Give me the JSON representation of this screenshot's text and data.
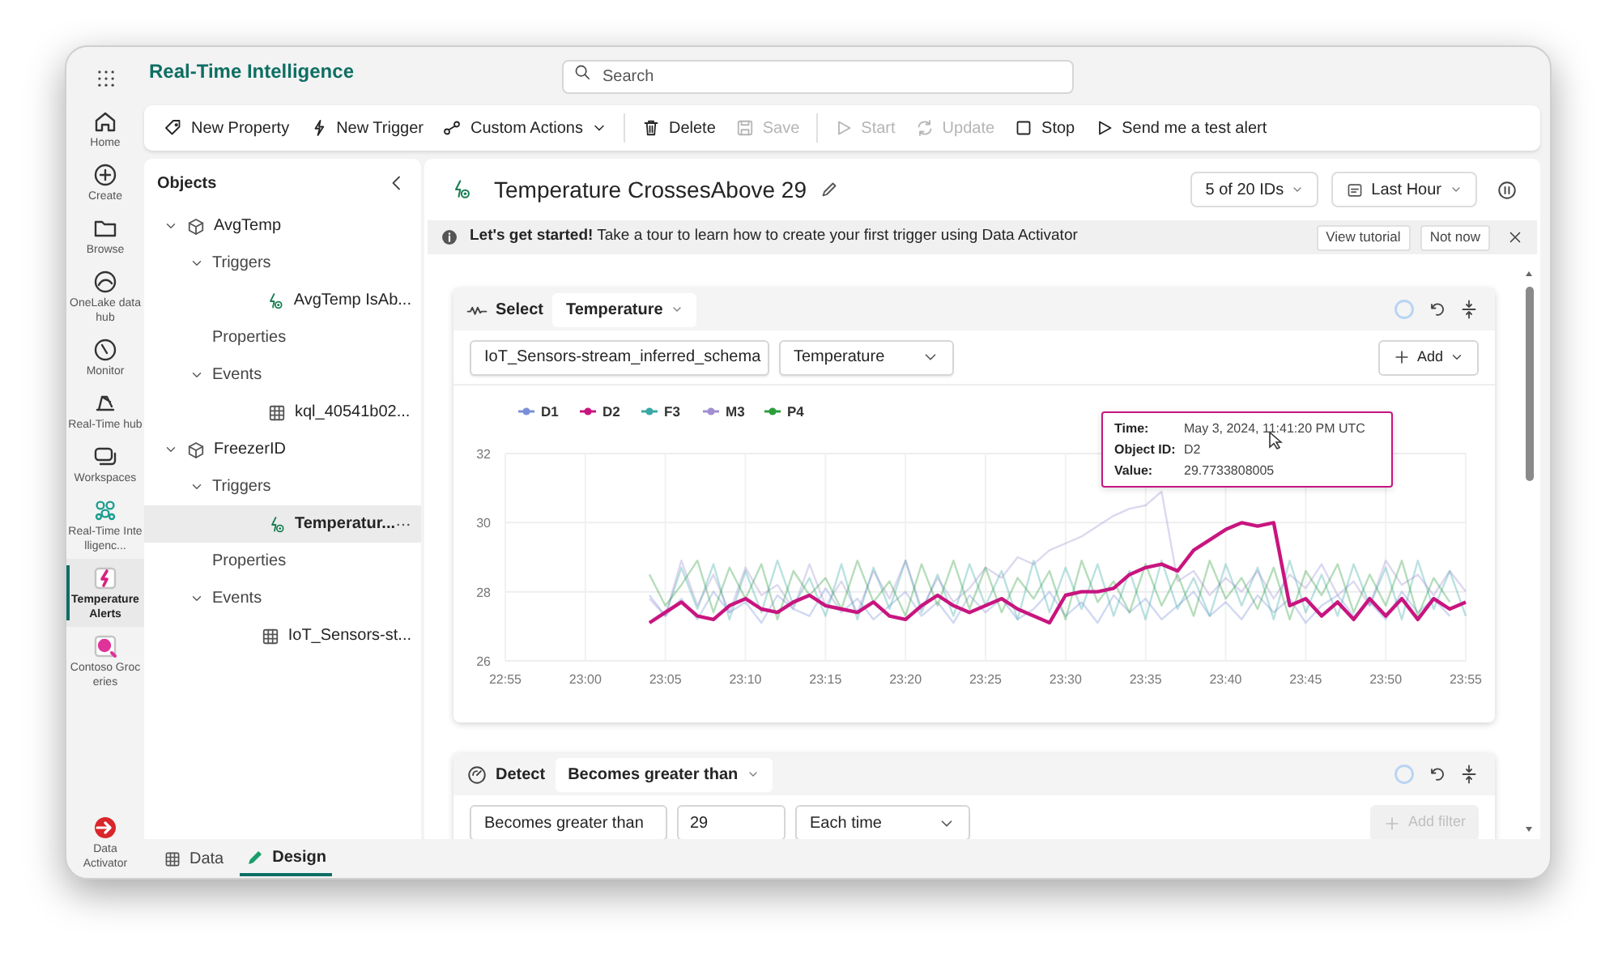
{
  "app_title": "Real-Time Intelligence",
  "search": {
    "placeholder": "Search"
  },
  "rail": [
    {
      "label": "Home",
      "selected": false
    },
    {
      "label": "Create",
      "selected": false
    },
    {
      "label": "Browse",
      "selected": false
    },
    {
      "label": "OneLake data hub",
      "selected": false
    },
    {
      "label": "Monitor",
      "selected": false
    },
    {
      "label": "Real-Time hub",
      "selected": false
    },
    {
      "label": "Workspaces",
      "selected": false
    },
    {
      "label": "Real-Time Intelligenc...",
      "selected": false
    },
    {
      "label": "TemperatureAlerts",
      "selected": true
    },
    {
      "label": "Contoso Groceries",
      "selected": false
    }
  ],
  "rail_footer": {
    "label": "Data Activator"
  },
  "toolbar": [
    [
      {
        "label": "New Property",
        "disabled": false,
        "dropdown": false
      },
      {
        "label": "New Trigger",
        "disabled": false,
        "dropdown": false
      },
      {
        "label": "Custom Actions",
        "disabled": false,
        "dropdown": true
      }
    ],
    [
      {
        "label": "Delete",
        "disabled": false,
        "dropdown": false
      },
      {
        "label": "Save",
        "disabled": true,
        "dropdown": false
      }
    ],
    [
      {
        "label": "Start",
        "disabled": true,
        "dropdown": false
      },
      {
        "label": "Update",
        "disabled": true,
        "dropdown": false
      },
      {
        "label": "Stop",
        "disabled": false,
        "dropdown": false
      },
      {
        "label": "Send me a test alert",
        "disabled": false,
        "dropdown": false
      }
    ]
  ],
  "objects": {
    "title": "Objects",
    "tree": [
      {
        "label": "AvgTemp",
        "kind": "object",
        "expanded": true,
        "children": [
          {
            "label": "Triggers",
            "kind": "folder",
            "expanded": true,
            "children": [
              {
                "label": "AvgTemp IsAb...",
                "kind": "trigger",
                "selected": false
              }
            ]
          },
          {
            "label": "Properties",
            "kind": "folder"
          },
          {
            "label": "Events",
            "kind": "folder",
            "expanded": true,
            "children": [
              {
                "label": "kql_40541b02...",
                "kind": "event",
                "selected": false
              }
            ]
          }
        ]
      },
      {
        "label": "FreezerID",
        "kind": "object",
        "expanded": true,
        "children": [
          {
            "label": "Triggers",
            "kind": "folder",
            "expanded": true,
            "children": [
              {
                "label": "Temperatur...",
                "kind": "trigger",
                "selected": true
              }
            ]
          },
          {
            "label": "Properties",
            "kind": "folder"
          },
          {
            "label": "Events",
            "kind": "folder",
            "expanded": true,
            "children": [
              {
                "label": "IoT_Sensors-st...",
                "kind": "event",
                "selected": false
              }
            ]
          }
        ]
      }
    ]
  },
  "header": {
    "title": "Temperature CrossesAbove 29",
    "ids": "5 of 20 IDs",
    "range": "Last Hour"
  },
  "banner": {
    "text": "**Let's get started!** Take a tour to learn how to create your first trigger using Data Activator",
    "buttons": [
      "View tutorial",
      "Not now"
    ]
  },
  "select_card": {
    "label": "Select",
    "choice": "Temperature",
    "source": "IoT_Sensors-stream_inferred_schema",
    "field": "Temperature",
    "add": "Add",
    "chart_data": {
      "type": "line",
      "categories": [
        "22:55",
        null,
        null,
        null,
        null,
        "23:00",
        null,
        null,
        null,
        null,
        "23:05",
        null,
        null,
        null,
        null,
        "23:10",
        null,
        null,
        null,
        null,
        "23:15",
        null,
        null,
        null,
        null,
        "23:20",
        null,
        null,
        null,
        null,
        "23:25",
        null,
        null,
        null,
        null,
        "23:30",
        null,
        null,
        null,
        null,
        "23:35",
        null,
        null,
        null,
        null,
        "23:40",
        null,
        null,
        null,
        null,
        "23:45",
        null,
        null,
        null,
        null,
        "23:50",
        null,
        null,
        null,
        null,
        "23:55"
      ],
      "ylim": [
        26,
        32
      ],
      "yticks": [
        26,
        28,
        30,
        32
      ],
      "grid": true,
      "legend": true,
      "series": [
        {
          "name": "D1",
          "color": "#7b8fd9",
          "values": [
            null,
            null,
            null,
            null,
            null,
            null,
            null,
            null,
            null,
            27.9,
            27.3,
            27.8,
            27.2,
            28.0,
            27.4,
            27.7,
            27.1,
            27.9,
            27.5,
            27.3,
            28.1,
            27.4,
            27.8,
            27.2,
            27.6,
            28.0,
            27.3,
            27.7,
            27.1,
            27.9,
            27.4,
            27.8,
            27.2,
            27.5,
            28.0,
            27.3,
            27.7,
            27.1,
            27.9,
            27.4,
            27.8,
            27.2,
            27.6,
            28.0,
            27.3,
            27.7,
            27.2,
            27.9,
            27.4,
            27.8,
            27.1,
            27.6,
            27.9,
            27.3,
            27.7,
            27.2,
            28.0,
            27.4,
            27.8,
            27.3,
            null
          ]
        },
        {
          "name": "D2",
          "color": "#c8157f",
          "values": [
            null,
            null,
            null,
            null,
            null,
            null,
            null,
            null,
            null,
            27.1,
            27.4,
            27.7,
            27.3,
            27.2,
            27.6,
            27.8,
            27.5,
            27.4,
            27.7,
            27.9,
            27.6,
            27.5,
            27.4,
            27.7,
            27.3,
            27.2,
            27.6,
            27.9,
            27.6,
            27.4,
            27.6,
            27.8,
            27.5,
            27.3,
            27.1,
            27.9,
            28.0,
            28.0,
            28.1,
            28.5,
            28.7,
            28.8,
            28.6,
            29.2,
            29.5,
            29.8,
            30.0,
            29.9,
            30.0,
            27.6,
            27.8,
            27.3,
            27.7,
            27.2,
            27.8,
            27.3,
            27.8,
            27.2,
            27.8,
            27.5,
            27.7
          ]
        },
        {
          "name": "F3",
          "color": "#3aa9a5",
          "values": [
            null,
            null,
            null,
            null,
            null,
            null,
            null,
            null,
            null,
            null,
            27.3,
            28.7,
            27.5,
            28.8,
            27.2,
            28.6,
            27.4,
            28.9,
            27.6,
            28.4,
            27.3,
            28.8,
            27.2,
            28.7,
            27.5,
            28.9,
            27.4,
            28.5,
            27.3,
            28.8,
            27.6,
            28.6,
            27.2,
            28.9,
            27.4,
            28.7,
            27.5,
            28.8,
            27.3,
            28.6,
            27.2,
            28.9,
            27.5,
            28.4,
            27.3,
            28.8,
            27.6,
            28.7,
            27.2,
            28.9,
            27.4,
            28.5,
            27.3,
            28.8,
            27.6,
            28.7,
            27.2,
            28.9,
            27.5,
            28.6,
            27.3
          ]
        },
        {
          "name": "M3",
          "color": "#9f8fd0",
          "values": [
            null,
            null,
            null,
            null,
            null,
            null,
            null,
            null,
            null,
            27.8,
            27.3,
            28.9,
            27.6,
            28.5,
            27.4,
            28.7,
            27.9,
            28.2,
            27.5,
            28.8,
            27.6,
            28.3,
            27.4,
            28.6,
            27.8,
            28.9,
            27.5,
            28.4,
            27.7,
            28.1,
            28.7,
            28.4,
            29.0,
            28.8,
            29.2,
            29.4,
            29.6,
            29.9,
            30.2,
            30.4,
            30.5,
            30.9,
            28.3,
            28.6,
            27.9,
            28.4,
            28.0,
            28.6,
            27.8,
            28.5,
            28.1,
            28.8,
            27.9,
            28.3,
            27.6,
            28.9,
            28.2,
            28.5,
            27.9,
            28.6,
            28.0
          ]
        },
        {
          "name": "P4",
          "color": "#2e9e3c",
          "values": [
            null,
            null,
            null,
            null,
            null,
            null,
            null,
            null,
            null,
            28.5,
            27.6,
            28.2,
            28.9,
            27.4,
            28.7,
            27.8,
            28.8,
            27.2,
            28.6,
            27.9,
            28.4,
            27.5,
            28.9,
            27.7,
            28.3,
            27.3,
            28.8,
            27.6,
            28.9,
            27.5,
            28.7,
            27.4,
            28.4,
            27.8,
            28.6,
            27.2,
            28.9,
            27.7,
            28.3,
            27.4,
            28.8,
            27.6,
            28.5,
            27.3,
            28.9,
            27.8,
            28.4,
            27.5,
            28.7,
            27.2,
            28.6,
            27.9,
            28.8,
            27.4,
            28.5,
            27.6,
            28.9,
            27.3,
            28.4,
            27.7,
            null
          ]
        }
      ]
    },
    "line_styles": [
      {
        "emphasized": false
      },
      {
        "emphasized": true
      },
      {
        "emphasized": false
      },
      {
        "emphasized": false
      },
      {
        "emphasized": false
      }
    ],
    "tooltip": [
      {
        "label": "Time:",
        "value": "May 3, 2024, 11:41:20 PM UTC"
      },
      {
        "label": "Object ID:",
        "value": "D2"
      },
      {
        "label": "Value:",
        "value": "29.7733808005"
      }
    ]
  },
  "detect_card": {
    "label": "Detect",
    "choice": "Becomes greater than",
    "condition": "Becomes greater than",
    "value": "29",
    "frequency": "Each time",
    "add_filter": {
      "label": "Add filter",
      "disabled": true
    }
  },
  "bottom_tabs": [
    {
      "label": "Data",
      "selected": false
    },
    {
      "label": "Design",
      "selected": true
    }
  ]
}
